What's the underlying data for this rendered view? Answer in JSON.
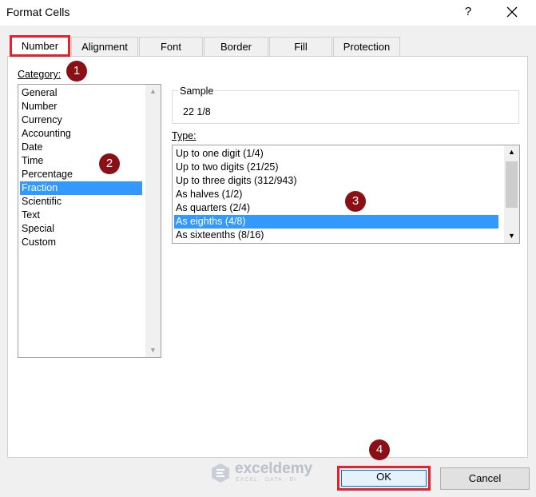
{
  "window": {
    "title": "Format Cells",
    "help_label": "?"
  },
  "tabs": [
    {
      "label": "Number",
      "active": true
    },
    {
      "label": "Alignment",
      "active": false
    },
    {
      "label": "Font",
      "active": false
    },
    {
      "label": "Border",
      "active": false
    },
    {
      "label": "Fill",
      "active": false
    },
    {
      "label": "Protection",
      "active": false
    }
  ],
  "category": {
    "label": "Category:",
    "items": [
      "General",
      "Number",
      "Currency",
      "Accounting",
      "Date",
      "Time",
      "Percentage",
      "Fraction",
      "Scientific",
      "Text",
      "Special",
      "Custom"
    ],
    "selected": "Fraction"
  },
  "sample": {
    "label": "Sample",
    "value": "22 1/8"
  },
  "type": {
    "label": "Type:",
    "items": [
      "Up to one digit (1/4)",
      "Up to two digits (21/25)",
      "Up to three digits (312/943)",
      "As halves (1/2)",
      "As quarters (2/4)",
      "As eighths (4/8)",
      "As sixteenths (8/16)"
    ],
    "selected": "As eighths (4/8)"
  },
  "badges": [
    "1",
    "2",
    "3",
    "4"
  ],
  "buttons": {
    "ok": "OK",
    "cancel": "Cancel"
  },
  "watermark": {
    "name": "exceldemy",
    "tagline": "EXCEL · DATA · BI"
  },
  "colors": {
    "selection": "#3399ff",
    "highlight_border": "#e8202a",
    "badge": "#8b1016"
  }
}
